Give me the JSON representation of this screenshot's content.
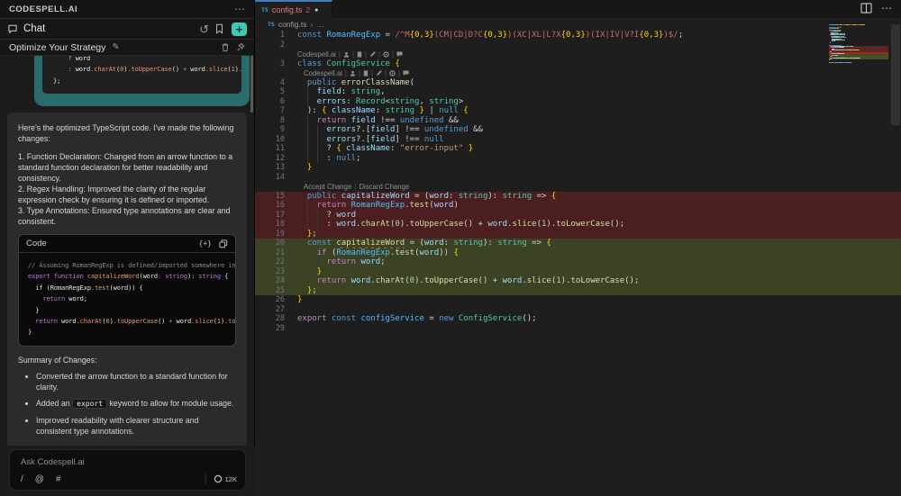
{
  "colors": {
    "accent": "#3ec9b6",
    "user_bubble": "#2a6b6b",
    "tab_error_fg": "#e07a76",
    "del_bg": "#4b1f1f",
    "ins_bg": "#3c4325",
    "chat_purple": "#c678dd",
    "chat_orange": "#e5996b",
    "chat_pink": "#e06c91",
    "syn_keyword": "#569cd6",
    "syn_control": "#c586c0",
    "syn_type": "#4ec9b0",
    "syn_func": "#dcdcaa",
    "syn_var": "#9cdcfe",
    "syn_const": "#4fc1ff",
    "syn_string": "#ce9178",
    "syn_regex": "#d16969",
    "syn_number": "#b5cea8",
    "syn_brace": "#ffd700"
  },
  "icons": {
    "more_h": "⋯",
    "history": "↺",
    "pencil": "✎",
    "plus": "+",
    "insert_code": "{+}",
    "slash": "/",
    "at": "@",
    "hash": "#",
    "divider": "|",
    "chevron": "›",
    "ellipsis": "…",
    "modified_dot": "●"
  },
  "sidebar": {
    "title": "CODESPELL.AI",
    "chat_label": "Chat",
    "session_title": "Optimize Your Strategy",
    "user_code_lines": [
      [
        [
          "or",
          "    ? "
        ],
        [
          "wh",
          "word"
        ]
      ],
      [
        [
          "or",
          "    : "
        ],
        [
          "wh",
          "word"
        ],
        [
          "or",
          ".charAt"
        ],
        [
          "wh",
          "("
        ],
        [
          "or",
          "0"
        ],
        [
          "wh",
          ")"
        ],
        [
          "or",
          ".toUpperCase"
        ],
        [
          "wh",
          "() "
        ],
        [
          "pk",
          "+"
        ],
        [
          "wh",
          " word"
        ],
        [
          "or",
          ".slice"
        ],
        [
          "wh",
          "("
        ],
        [
          "or",
          "1"
        ],
        [
          "wh",
          ")"
        ],
        [
          "or",
          ".toLowerCase();"
        ]
      ],
      [
        [
          "wh",
          "};"
        ]
      ]
    ],
    "message": {
      "intro": "Here's the optimized TypeScript code. I've made the following changes:",
      "points": [
        "1. Function Declaration: Changed from an arrow function to a standard function declaration for better readability and consistency.",
        "2. Regex Handling: Improved the clarity of the regular expression check by ensuring it is defined or imported.",
        "3. Type Annotations: Ensured type annotations are clear and consistent."
      ],
      "code_card": {
        "title": "Code",
        "lines": [
          [
            [
              "cm",
              "// Assuming RomanRegExp is defined/imported somewhere in your"
            ]
          ],
          [
            [
              "pu",
              "export function "
            ],
            [
              "or",
              "capitalizeWord"
            ],
            [
              "wh",
              "(word"
            ],
            [
              "pu",
              ": string"
            ],
            [
              "wh",
              "): "
            ],
            [
              "pu",
              "string"
            ],
            [
              "wh",
              " {"
            ]
          ],
          [
            [
              "wh",
              "  if ("
            ],
            [
              "wh",
              "RomanRegExp"
            ],
            [
              "or",
              ".test"
            ],
            [
              "wh",
              "(word)) {"
            ]
          ],
          [
            [
              "pu",
              "    return "
            ],
            [
              "wh",
              "word;"
            ]
          ],
          [
            [
              "wh",
              "  }"
            ]
          ],
          [
            [
              "pu",
              "  return "
            ],
            [
              "wh",
              "word"
            ],
            [
              "or",
              ".charAt"
            ],
            [
              "wh",
              "("
            ],
            [
              "or",
              "0"
            ],
            [
              "wh",
              ")"
            ],
            [
              "or",
              ".toUpperCase"
            ],
            [
              "wh",
              "() "
            ],
            [
              "pk",
              "+"
            ],
            [
              "wh",
              " word"
            ],
            [
              "or",
              ".slice"
            ],
            [
              "wh",
              "("
            ],
            [
              "or",
              "1"
            ],
            [
              "wh",
              ")"
            ],
            [
              "or",
              ".toLowerCase();"
            ]
          ],
          [
            [
              "wh",
              "}"
            ]
          ]
        ]
      },
      "summary_title": "Summary of Changes:",
      "bullets": [
        {
          "pre": "Converted the arrow function to a standard function for clarity.",
          "code": null,
          "post": ""
        },
        {
          "pre": "Added an ",
          "code": "export",
          "post": " keyword to allow for module usage."
        },
        {
          "pre": "Improved readability with clearer structure and consistent type annotations.",
          "code": null,
          "post": ""
        }
      ]
    },
    "input": {
      "placeholder": "Ask Codespell.ai",
      "token_count": "12K"
    }
  },
  "editor": {
    "tab": {
      "ts": "TS",
      "name": "config.ts",
      "error_count": "2"
    },
    "breadcrumb": {
      "ts": "TS",
      "file": "config.ts"
    },
    "codelens": {
      "ai_label": "Codespell.ai",
      "icon_names": [
        "ai-avatar-icon",
        "doc-icon",
        "pencil-icon",
        "gear-icon",
        "comment-icon"
      ],
      "accept_label": "Accept Change",
      "discard_label": "Discard Change"
    },
    "rows": [
      {
        "t": "code",
        "n": 1,
        "seg": [
          [
            "k",
            "const "
          ],
          [
            "V",
            "RomanRegExp"
          ],
          [
            "p",
            " = "
          ],
          [
            "r",
            "/^M"
          ],
          [
            "y",
            "{0,3}"
          ],
          [
            "r",
            "(CM|CD|D?C"
          ],
          [
            "y",
            "{0,3}"
          ],
          [
            "r",
            ")(XC|XL|L?X"
          ],
          [
            "y",
            "{0,3}"
          ],
          [
            "r",
            ")(IX|IV|V?I"
          ],
          [
            "y",
            "{0,3}"
          ],
          [
            "r",
            ")$/"
          ],
          [
            "p",
            ";"
          ]
        ]
      },
      {
        "t": "code",
        "n": 2,
        "seg": []
      },
      {
        "t": "lens-ai",
        "indent": 0
      },
      {
        "t": "code",
        "n": 3,
        "seg": [
          [
            "k",
            "class "
          ],
          [
            "t",
            "ConfigService "
          ],
          [
            "y",
            "{"
          ]
        ]
      },
      {
        "t": "lens-ai",
        "indent": 1
      },
      {
        "t": "code",
        "n": 4,
        "seg": [
          [
            "k",
            "  public "
          ],
          [
            "f",
            "errorClassName"
          ],
          [
            "p",
            "("
          ]
        ]
      },
      {
        "t": "code",
        "n": 5,
        "seg": [
          [
            "v",
            "    field"
          ],
          [
            "p",
            ": "
          ],
          [
            "t",
            "string"
          ],
          [
            "p",
            ","
          ]
        ]
      },
      {
        "t": "code",
        "n": 6,
        "seg": [
          [
            "v",
            "    errors"
          ],
          [
            "p",
            ": "
          ],
          [
            "t",
            "Record"
          ],
          [
            "p",
            "<"
          ],
          [
            "t",
            "string"
          ],
          [
            "p",
            ", "
          ],
          [
            "t",
            "string"
          ],
          [
            "p",
            ">"
          ]
        ]
      },
      {
        "t": "code",
        "n": 7,
        "seg": [
          [
            "p",
            "  ): "
          ],
          [
            "y",
            "{ "
          ],
          [
            "v",
            "className"
          ],
          [
            "p",
            ": "
          ],
          [
            "t",
            "string"
          ],
          [
            "y",
            " }"
          ],
          [
            "p",
            " | "
          ],
          [
            "k",
            "null"
          ],
          [
            "p",
            " "
          ],
          [
            "y",
            "{"
          ]
        ]
      },
      {
        "t": "code",
        "n": 8,
        "seg": [
          [
            "c",
            "    return "
          ],
          [
            "v",
            "field "
          ],
          [
            "p",
            "!== "
          ],
          [
            "k",
            "undefined"
          ],
          [
            "p",
            " &&"
          ]
        ]
      },
      {
        "t": "code",
        "n": 9,
        "seg": [
          [
            "v",
            "      errors"
          ],
          [
            "p",
            "?.["
          ],
          [
            "v",
            "field"
          ],
          [
            "p",
            "] !== "
          ],
          [
            "k",
            "undefined"
          ],
          [
            "p",
            " &&"
          ]
        ]
      },
      {
        "t": "code",
        "n": 10,
        "seg": [
          [
            "v",
            "      errors"
          ],
          [
            "p",
            "?.["
          ],
          [
            "v",
            "field"
          ],
          [
            "p",
            "] !== "
          ],
          [
            "k",
            "null"
          ]
        ]
      },
      {
        "t": "code",
        "n": 11,
        "seg": [
          [
            "p",
            "      ? "
          ],
          [
            "y",
            "{ "
          ],
          [
            "v",
            "className"
          ],
          [
            "p",
            ": "
          ],
          [
            "s",
            "\"error-input\""
          ],
          [
            "y",
            " }"
          ]
        ]
      },
      {
        "t": "code",
        "n": 12,
        "seg": [
          [
            "p",
            "      : "
          ],
          [
            "k",
            "null"
          ],
          [
            "p",
            ";"
          ]
        ]
      },
      {
        "t": "code",
        "n": 13,
        "seg": [
          [
            "y",
            "  }"
          ]
        ]
      },
      {
        "t": "code",
        "n": 14,
        "seg": []
      },
      {
        "t": "lens-diff",
        "indent": 1
      },
      {
        "t": "code",
        "n": 15,
        "bg": "del",
        "seg": [
          [
            "k",
            "  public "
          ],
          [
            "v",
            "capitalizeWord"
          ],
          [
            "p",
            " = ("
          ],
          [
            "v",
            "word"
          ],
          [
            "p",
            ": "
          ],
          [
            "t",
            "string"
          ],
          [
            "p",
            "): "
          ],
          [
            "t",
            "string"
          ],
          [
            "p",
            " => "
          ],
          [
            "y",
            "{"
          ]
        ]
      },
      {
        "t": "code",
        "n": 16,
        "bg": "del",
        "seg": [
          [
            "c",
            "    return "
          ],
          [
            "V",
            "RomanRegExp"
          ],
          [
            "p",
            "."
          ],
          [
            "f",
            "test"
          ],
          [
            "p",
            "("
          ],
          [
            "v",
            "word"
          ],
          [
            "p",
            ")"
          ]
        ]
      },
      {
        "t": "code",
        "n": 17,
        "bg": "del",
        "seg": [
          [
            "p",
            "      ? "
          ],
          [
            "v",
            "word"
          ]
        ]
      },
      {
        "t": "code",
        "n": 18,
        "bg": "del",
        "seg": [
          [
            "p",
            "      : "
          ],
          [
            "v",
            "word"
          ],
          [
            "p",
            "."
          ],
          [
            "f",
            "charAt"
          ],
          [
            "p",
            "("
          ],
          [
            "d",
            "0"
          ],
          [
            "p",
            ")."
          ],
          [
            "f",
            "toUpperCase"
          ],
          [
            "p",
            "() + "
          ],
          [
            "v",
            "word"
          ],
          [
            "p",
            "."
          ],
          [
            "f",
            "slice"
          ],
          [
            "p",
            "("
          ],
          [
            "d",
            "1"
          ],
          [
            "p",
            ")."
          ],
          [
            "f",
            "toLowerCase"
          ],
          [
            "p",
            "();"
          ]
        ]
      },
      {
        "t": "code",
        "n": 19,
        "bg": "del",
        "seg": [
          [
            "y",
            "  }"
          ],
          [
            "p",
            ";"
          ]
        ]
      },
      {
        "t": "code",
        "n": 20,
        "bg": "ins",
        "seg": [
          [
            "k",
            "  const "
          ],
          [
            "f q",
            "capitalizeWord"
          ],
          [
            "p",
            " = ("
          ],
          [
            "v",
            "word"
          ],
          [
            "p",
            ": "
          ],
          [
            "t",
            "string"
          ],
          [
            "p",
            "): "
          ],
          [
            "t",
            "string"
          ],
          [
            "p",
            " => "
          ],
          [
            "y",
            "{"
          ]
        ]
      },
      {
        "t": "code",
        "n": 21,
        "bg": "ins",
        "seg": [
          [
            "c",
            "    if "
          ],
          [
            "p",
            "("
          ],
          [
            "V",
            "RomanRegExp"
          ],
          [
            "p",
            "."
          ],
          [
            "f",
            "test"
          ],
          [
            "p",
            "("
          ],
          [
            "v",
            "word"
          ],
          [
            "p",
            ")) "
          ],
          [
            "y",
            "{"
          ]
        ]
      },
      {
        "t": "code",
        "n": 22,
        "bg": "ins",
        "seg": [
          [
            "c",
            "      return "
          ],
          [
            "v",
            "word"
          ],
          [
            "p",
            ";"
          ]
        ]
      },
      {
        "t": "code",
        "n": 23,
        "bg": "ins",
        "seg": [
          [
            "y",
            "    }"
          ]
        ]
      },
      {
        "t": "code",
        "n": 24,
        "bg": "ins",
        "seg": [
          [
            "c",
            "    return "
          ],
          [
            "v",
            "word"
          ],
          [
            "p",
            "."
          ],
          [
            "f",
            "charAt"
          ],
          [
            "p",
            "("
          ],
          [
            "d",
            "0"
          ],
          [
            "p",
            ")."
          ],
          [
            "f",
            "toUpperCase"
          ],
          [
            "p",
            "() + "
          ],
          [
            "v",
            "word"
          ],
          [
            "p",
            "."
          ],
          [
            "f",
            "slice"
          ],
          [
            "p",
            "("
          ],
          [
            "d",
            "1"
          ],
          [
            "p",
            ")."
          ],
          [
            "f",
            "toLowerCase"
          ],
          [
            "p",
            "();"
          ]
        ]
      },
      {
        "t": "code",
        "n": 25,
        "bg": "ins",
        "seg": [
          [
            "y",
            "  }"
          ],
          [
            "p",
            ";"
          ]
        ]
      },
      {
        "t": "code",
        "n": 26,
        "seg": [
          [
            "y",
            "}"
          ]
        ]
      },
      {
        "t": "code",
        "n": 27,
        "seg": []
      },
      {
        "t": "code",
        "n": 28,
        "seg": [
          [
            "c",
            "export "
          ],
          [
            "k",
            "const "
          ],
          [
            "V",
            "configService"
          ],
          [
            "p",
            " = "
          ],
          [
            "k",
            "new "
          ],
          [
            "t",
            "ConfigService"
          ],
          [
            "p",
            "();"
          ]
        ]
      },
      {
        "t": "code",
        "n": 29,
        "seg": []
      }
    ]
  }
}
